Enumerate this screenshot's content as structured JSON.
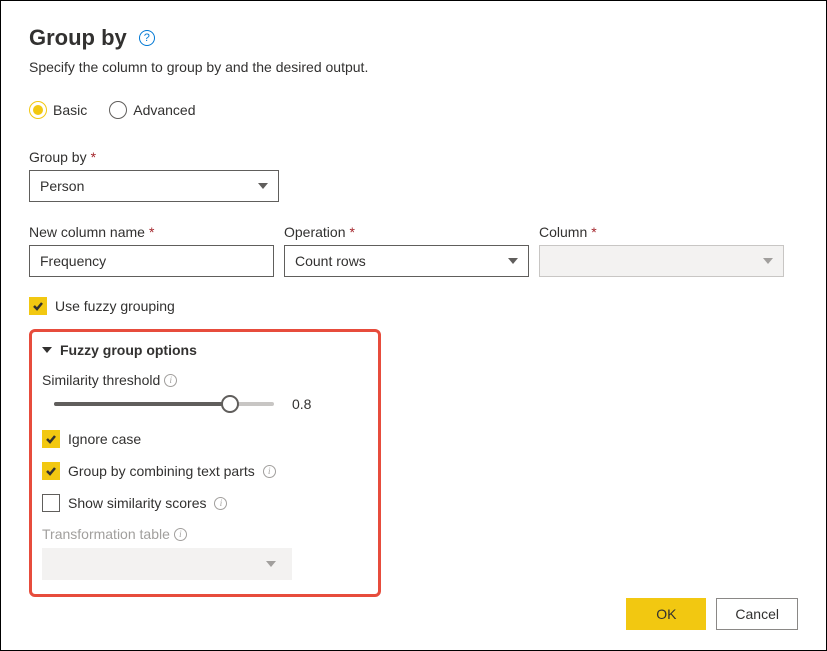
{
  "title": "Group by",
  "subtitle": "Specify the column to group by and the desired output.",
  "mode": {
    "basic_label": "Basic",
    "advanced_label": "Advanced",
    "selected": "basic"
  },
  "group_by": {
    "label": "Group by",
    "value": "Person"
  },
  "new_column": {
    "label": "New column name",
    "value": "Frequency"
  },
  "operation": {
    "label": "Operation",
    "value": "Count rows"
  },
  "column": {
    "label": "Column",
    "value": ""
  },
  "use_fuzzy": {
    "label": "Use fuzzy grouping",
    "checked": true
  },
  "fuzzy": {
    "section_title": "Fuzzy group options",
    "similarity_label": "Similarity threshold",
    "similarity_value": "0.8",
    "ignore_case": {
      "label": "Ignore case",
      "checked": true
    },
    "combine_parts": {
      "label": "Group by combining text parts",
      "checked": true
    },
    "show_scores": {
      "label": "Show similarity scores",
      "checked": false
    },
    "transform_table_label": "Transformation table"
  },
  "buttons": {
    "ok": "OK",
    "cancel": "Cancel"
  }
}
